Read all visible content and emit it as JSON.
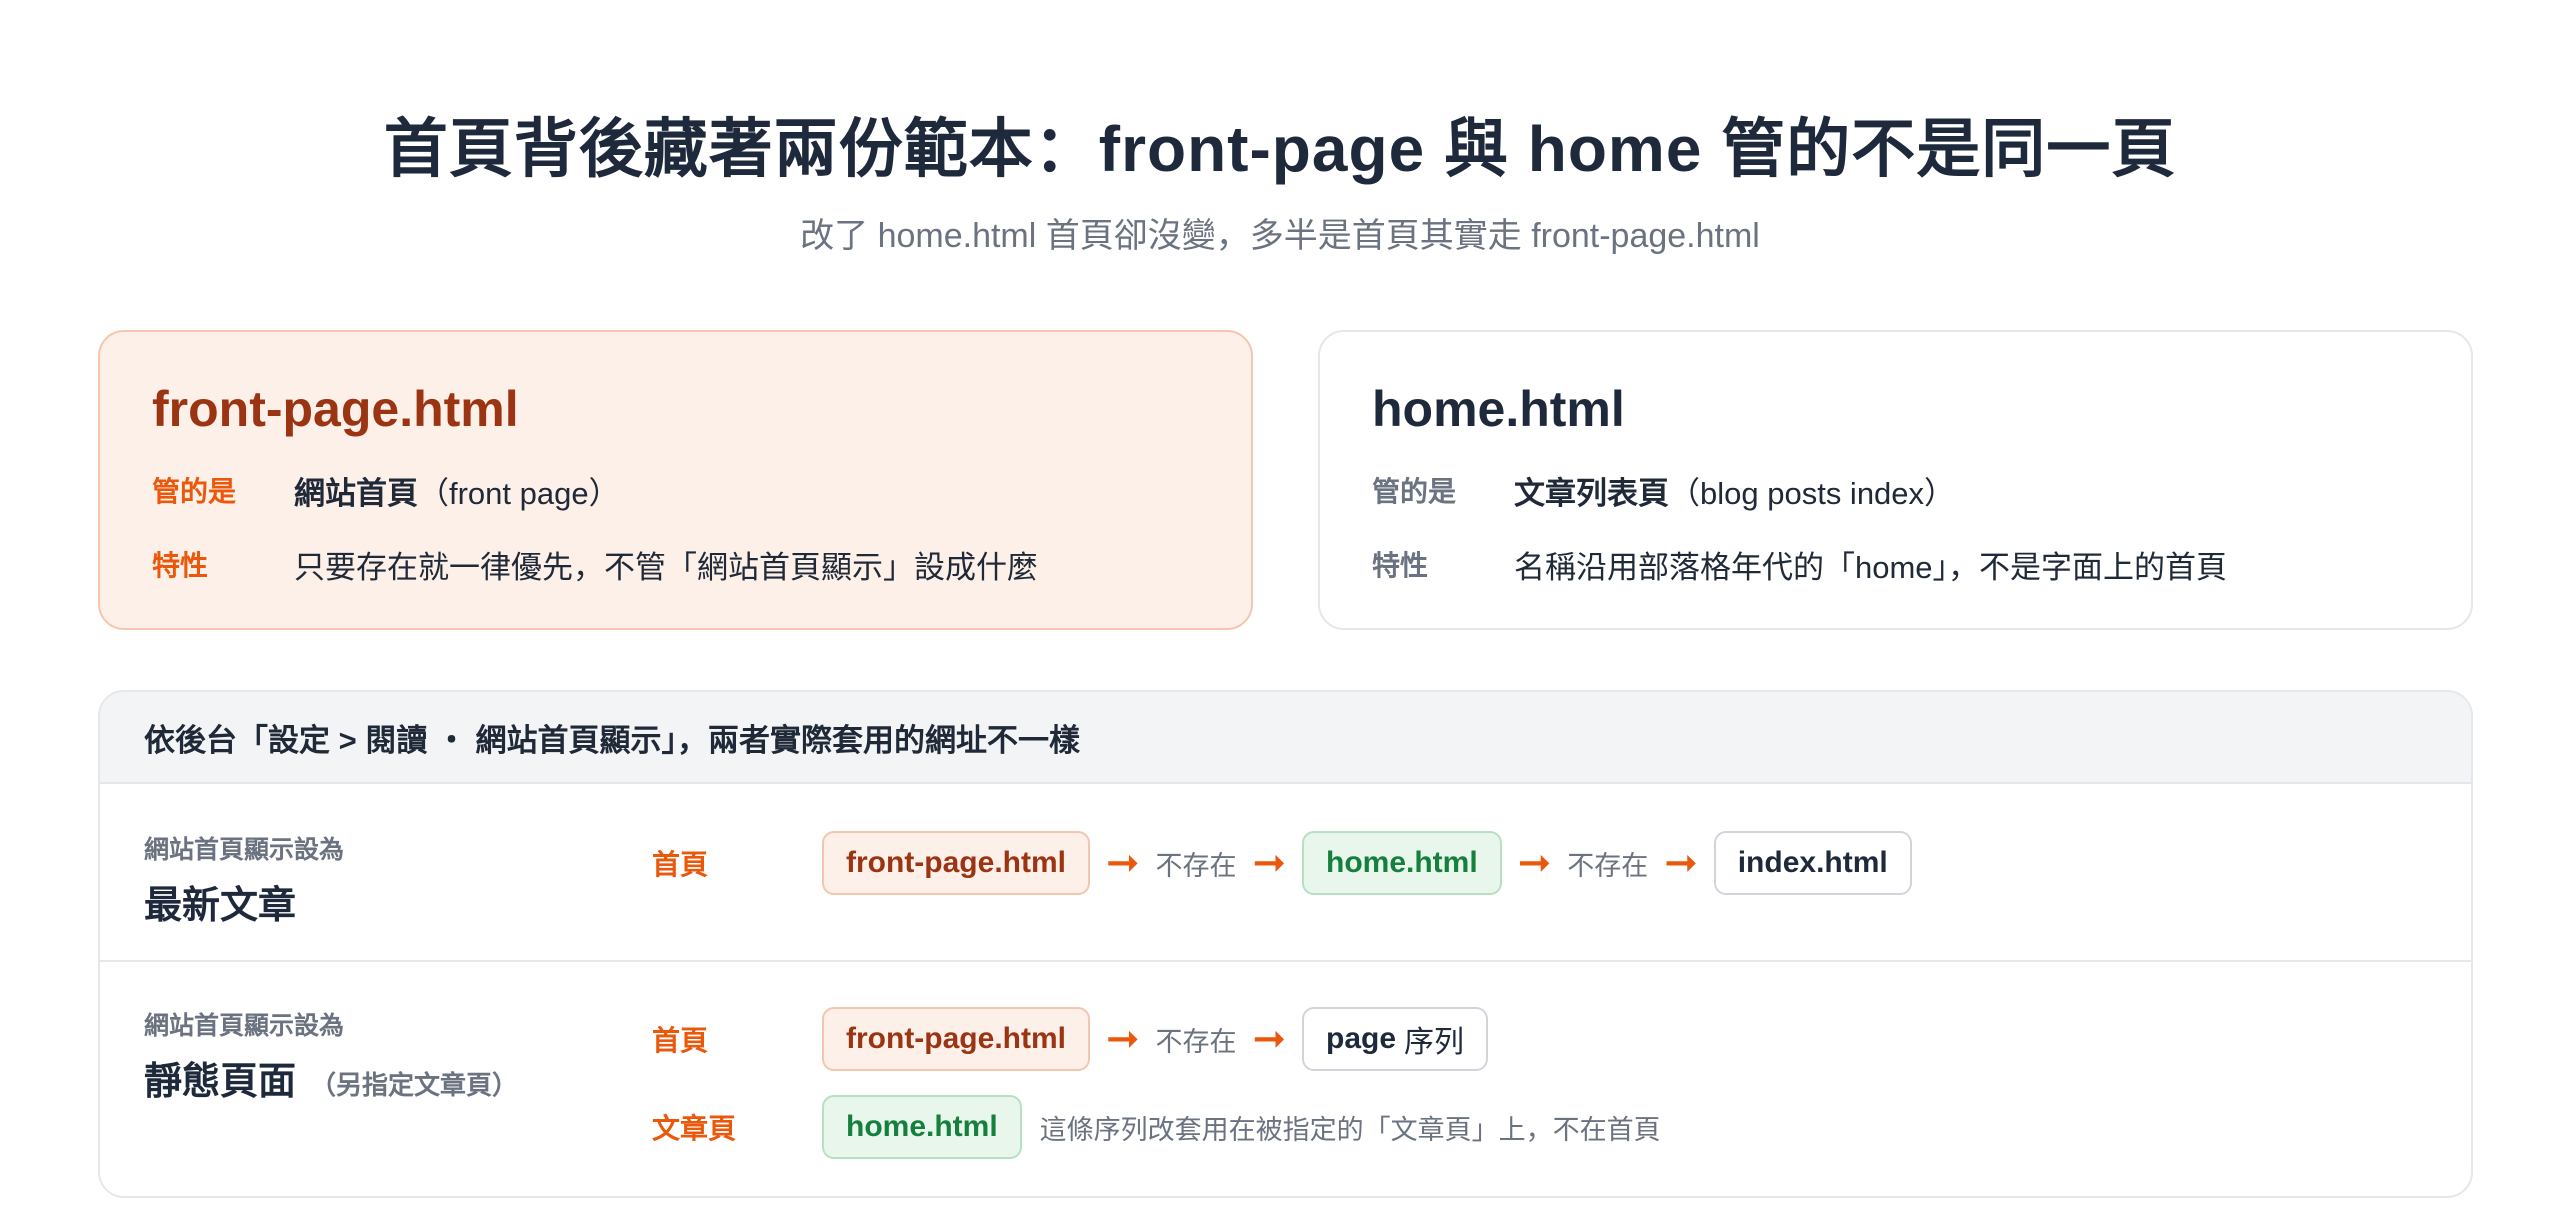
{
  "header": {
    "title": "首頁背後藏著兩份範本：front-page 與 home 管的不是同一頁",
    "subtitle": "改了 home.html 首頁卻沒變，多半是首頁其實走 front-page.html"
  },
  "cards": {
    "front_page": {
      "title": "front-page.html",
      "manages_label": "管的是",
      "manages_bold": "網站首頁",
      "manages_extra": "（front page）",
      "trait_label": "特性",
      "trait_value": "只要存在就一律優先，不管「網站首頁顯示」設成什麼"
    },
    "home": {
      "title": "home.html",
      "manages_label": "管的是",
      "manages_bold": "文章列表頁",
      "manages_extra": "（blog posts index）",
      "trait_label": "特性",
      "trait_value": "名稱沿用部落格年代的「home」，不是字面上的首頁"
    }
  },
  "panel": {
    "heading": "依後台「設定 > 閱讀 ・ 網站首頁顯示」，兩者實際套用的網址不一樣",
    "rows": [
      {
        "setting_label": "網站首頁顯示設為",
        "setting_value": "最新文章",
        "chain_type": "首頁",
        "step1": "front-page.html",
        "missing1": "不存在",
        "step2": "home.html",
        "missing2": "不存在",
        "step3": "index.html"
      },
      {
        "setting_label": "網站首頁顯示設為",
        "setting_value": "靜態頁面",
        "setting_note": "（另指定文章頁）",
        "chain_type": "首頁",
        "step1": "front-page.html",
        "missing1": "不存在",
        "step2_bold": "page",
        "step2_thin": "序列",
        "chain2_type": "文章頁",
        "chain2_step": "home.html",
        "chain2_note": "這條序列改套用在被指定的「文章頁」上，不在首頁"
      }
    ]
  },
  "colors": {
    "accent": "#ea580c",
    "accent_dark": "#9a3412",
    "green": "#15803d",
    "muted": "#6b7280"
  }
}
